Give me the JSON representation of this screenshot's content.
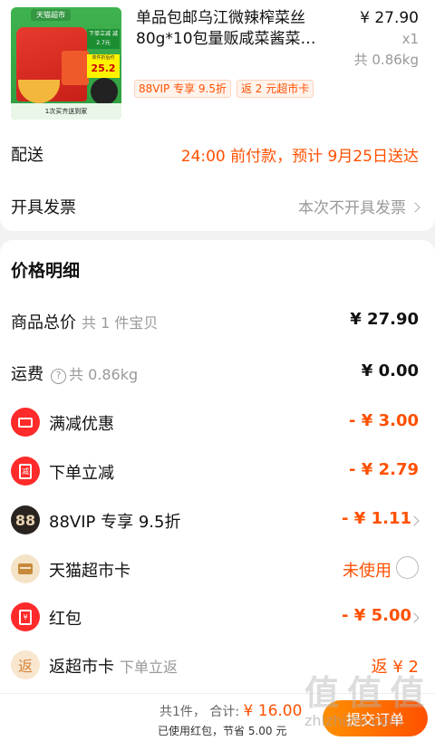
{
  "product": {
    "image_tag": "天猫超市",
    "image_badge1": "下单立减 减2.7元",
    "image_badge2_small": "单件折后约",
    "image_badge2": "25.2",
    "image_bottom": "1次买齐送到家",
    "title_line1": "单品包邮乌江微辣榨菜丝",
    "title_line2": "80g*10包量贩咸菜酱菜…",
    "price": "¥ 27.90",
    "qty": "x1",
    "weight": "共 0.86kg",
    "tags": [
      "88VIP 专享 9.5折",
      "返 2 元超市卡"
    ]
  },
  "delivery": {
    "label": "配送",
    "value": "24:00 前付款，预计 9月25日送达"
  },
  "invoice": {
    "label": "开具发票",
    "value": "本次不开具发票"
  },
  "price_detail": {
    "title": "价格明细",
    "rows": [
      {
        "label": "商品总价",
        "sub": "共 1 件宝贝",
        "value": "¥ 27.90"
      },
      {
        "label": "运费",
        "sub": "共 0.86kg",
        "value": "¥ 0.00"
      },
      {
        "label": "满减优惠",
        "value": "- ¥ 3.00",
        "icon": "ticket-icon"
      },
      {
        "label": "下单立减",
        "value": "- ¥ 2.79",
        "icon": "discount-icon",
        "icon_text": "减"
      },
      {
        "label": "88VIP 专享 9.5折",
        "value": "- ¥ 1.11",
        "icon": "88vip-icon",
        "icon_text": "88"
      },
      {
        "label": "天猫超市卡",
        "value": "未使用",
        "icon": "card-icon"
      },
      {
        "label": "红包",
        "value": "- ¥ 5.00",
        "icon": "red-packet-icon",
        "icon_text": "¥"
      },
      {
        "label": "返超市卡",
        "sub": "下单立返",
        "value": "返 ¥ 2",
        "icon": "rebate-icon",
        "icon_text": "返"
      }
    ]
  },
  "footer": {
    "count": "共1件，",
    "total_label": "合计:",
    "total": "¥ 16.00",
    "saved": "已使用红包，节省 5.00 元",
    "submit": "提交订单",
    "watermark": "值 值 值",
    "watermark_url": "zhizhizhi.com"
  },
  "colors": {
    "accent": "#ff5000",
    "red": "#ff2a2a"
  }
}
